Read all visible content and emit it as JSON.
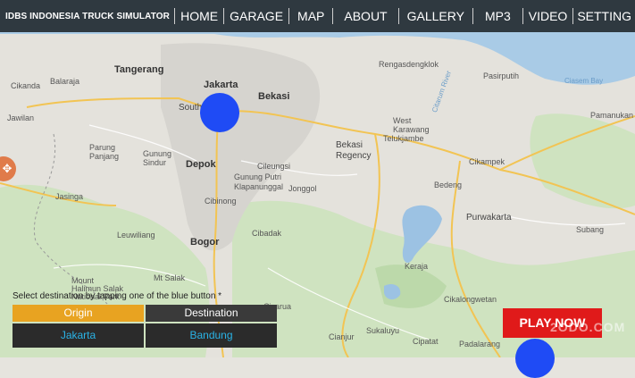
{
  "header": {
    "title": "IDBS INDONESIA TRUCK SIMULATOR",
    "nav": [
      {
        "label": "HOME"
      },
      {
        "label": "GARAGE"
      },
      {
        "label": "MAP"
      },
      {
        "label": "ABOUT"
      },
      {
        "label": "GALLERY"
      },
      {
        "label": "MP3"
      },
      {
        "label": "VIDEO"
      },
      {
        "label": "SETTING"
      }
    ]
  },
  "map": {
    "places": {
      "tangerang": "Tangerang",
      "jakarta": "Jakarta",
      "bekasi": "Bekasi",
      "bekasi_regency": "Bekasi\nRegency",
      "depok": "Depok",
      "bogor": "Bogor",
      "purwakarta": "Purwakarta",
      "cikarang": "Rengasdengklok",
      "pamanukan": "Pamanukan",
      "pasirputih": "Pasirputih",
      "citarum": "Citarum River",
      "west_karawang": "West\nKarawang",
      "telukjambe": "Telukjambe",
      "cikampek": "Cikampek",
      "subang": "Subang",
      "bedeng": "Bedeng",
      "cikande": "Cikanda",
      "balaraja": "Balaraja",
      "jawilan": "Jawilan",
      "parung": "Parung\nPanjang",
      "gunung_sindur": "Gunung\nSindur",
      "cileungsi": "Cileungsi",
      "jonggol": "Jonggol",
      "gunung_putri": "Gunung Putri",
      "klapanunggal": "Klapanunggal",
      "cibinong": "Cibinong",
      "jasinga": "Jasinga",
      "leuwiliang": "Leuwiliang",
      "cibadak": "Cibadak",
      "keraja": "Keraja",
      "cikalong": "Cikalongwetan",
      "salak": "Mt Salak",
      "halimun": "Mount\nHalimun Salak\nNational Park",
      "ciganjur": "Cisarua",
      "sukaluyu": "Sukaluyu",
      "cipatat": "Cipatat",
      "padalarang": "Padalarang",
      "cianjur": "Cianjur",
      "cisalak_bay": "Ciasem Bay",
      "south": "South"
    }
  },
  "markers": [
    {
      "name": "jakarta-marker"
    },
    {
      "name": "bandung-marker"
    }
  ],
  "side_button": {
    "icon": "✥"
  },
  "selection": {
    "instruction": "Select destination by tapping one of the blue button *",
    "origin_label": "Origin",
    "destination_label": "Destination",
    "origin_value": "Jakarta",
    "destination_value": "Bandung"
  },
  "play_button": {
    "label": "PLAY NOW"
  },
  "watermark": "2ODO.COM",
  "colors": {
    "accent": "#e8a321",
    "marker": "#1f4bf5",
    "play": "#e01a1a",
    "value_text": "#2ab3e6"
  }
}
